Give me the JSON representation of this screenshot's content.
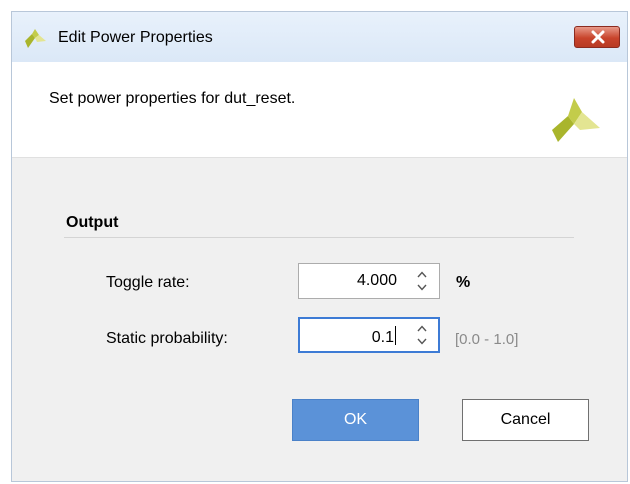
{
  "window": {
    "title": "Edit Power Properties"
  },
  "header": {
    "text": "Set power properties for dut_reset."
  },
  "section": {
    "title": "Output"
  },
  "fields": {
    "toggle_rate": {
      "label": "Toggle rate:",
      "value": "4.000",
      "unit": "%"
    },
    "static_probability": {
      "label": "Static probability:",
      "value": "0.1",
      "range_hint": "[0.0 - 1.0]"
    }
  },
  "buttons": {
    "ok": "OK",
    "cancel": "Cancel"
  },
  "colors": {
    "accent": "#5b92d8",
    "focus_border": "#3d7bd5",
    "logo_yellow": "#a9b52c",
    "logo_light": "#e3e592"
  }
}
